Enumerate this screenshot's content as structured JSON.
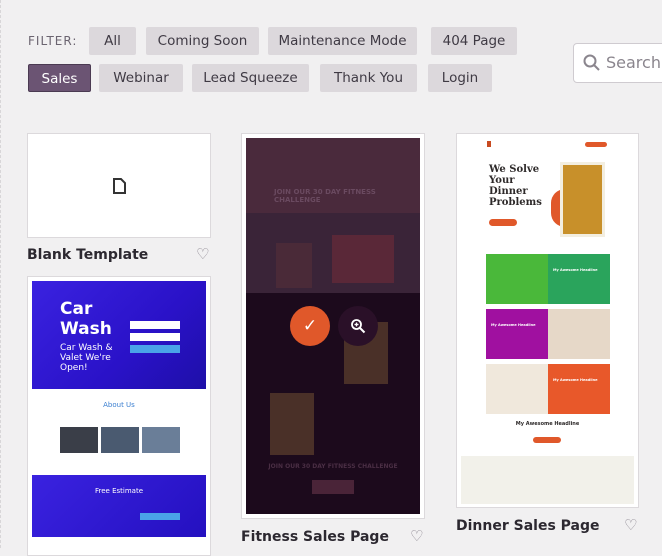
{
  "filter": {
    "label": "FILTER:",
    "items": [
      {
        "label": "All",
        "active": false
      },
      {
        "label": "Coming Soon",
        "active": false
      },
      {
        "label": "Maintenance Mode",
        "active": false
      },
      {
        "label": "404 Page",
        "active": false
      },
      {
        "label": "Sales",
        "active": true
      },
      {
        "label": "Webinar",
        "active": false
      },
      {
        "label": "Lead Squeeze",
        "active": false
      },
      {
        "label": "Thank You",
        "active": false
      },
      {
        "label": "Login",
        "active": false
      }
    ]
  },
  "search": {
    "placeholder": "Search"
  },
  "templates": [
    {
      "name": "Blank Template"
    },
    {
      "name": "Fitness Sales Page",
      "preview": {
        "headline": "JOIN OUR 30 DAY FITNESS CHALLENGE",
        "footer": "JOIN OUR 30 DAY FITNESS CHALLENGE"
      }
    },
    {
      "name": "Dinner Sales Page",
      "preview": {
        "hero": "We Solve Your Dinner Problems",
        "blocks": [
          "My Awesome Headline",
          "My Awesome Headline",
          "My Awesome Headline"
        ],
        "bottom": "My Awesome Headline"
      }
    },
    {
      "name": "",
      "preview": {
        "title1": "Car",
        "title2": "Wash",
        "sub": "Car Wash & Valet We're Open!",
        "about": "About Us",
        "estimate": "Free Estimate"
      }
    }
  ],
  "colors": {
    "accent": "#e0582a",
    "active_filter": "#6b5473",
    "overlay": "#1c0a1c"
  }
}
